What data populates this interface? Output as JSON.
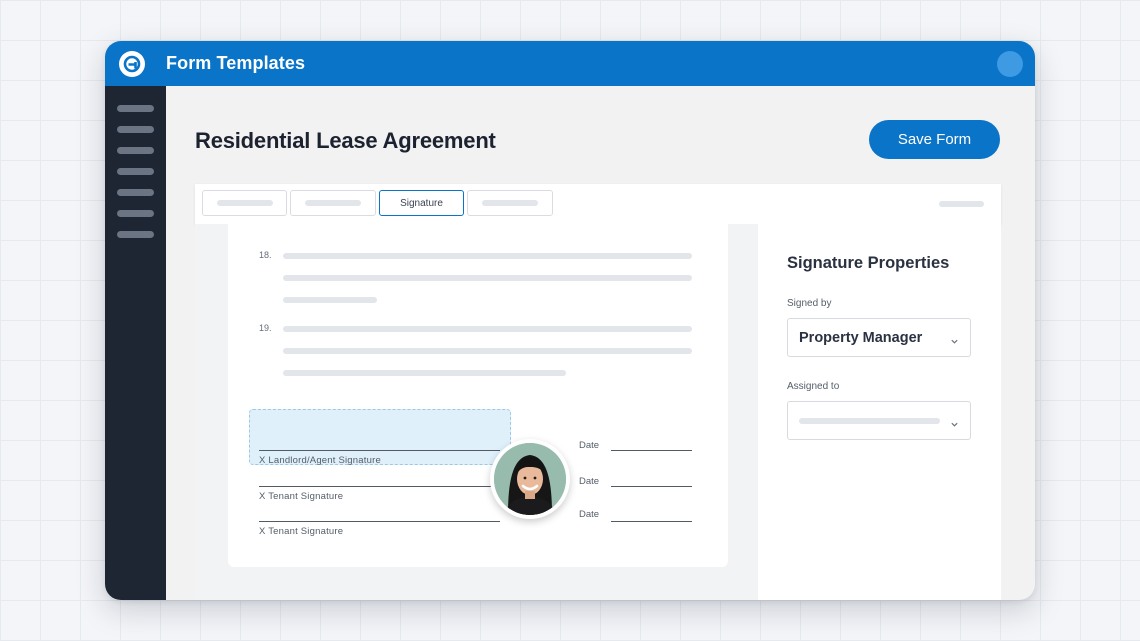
{
  "app": {
    "title": "Form Templates"
  },
  "page": {
    "title": "Residential Lease Agreement",
    "save_label": "Save Form"
  },
  "tabs": [
    {
      "label": ""
    },
    {
      "label": ""
    },
    {
      "label": "Signature",
      "active": true
    },
    {
      "label": ""
    }
  ],
  "document": {
    "clauses": [
      {
        "number": "18."
      },
      {
        "number": "19."
      }
    ],
    "signatures": [
      {
        "label": "X Landlord/Agent Signature",
        "date_label": "Date",
        "highlighted": true
      },
      {
        "label": "X Tenant Signature",
        "date_label": "Date"
      },
      {
        "label": "X Tenant Signature",
        "date_label": "Date"
      }
    ]
  },
  "properties": {
    "title": "Signature Properties",
    "signed_by": {
      "label": "Signed by",
      "value": "Property Manager"
    },
    "assigned_to": {
      "label": "Assigned to",
      "value": ""
    }
  },
  "colors": {
    "brand": "#0a74c9",
    "sidebar": "#1f2633",
    "highlight": "#dff0fb"
  },
  "icons": [
    "app-logo-icon",
    "chevron-down-icon",
    "user-avatar"
  ]
}
